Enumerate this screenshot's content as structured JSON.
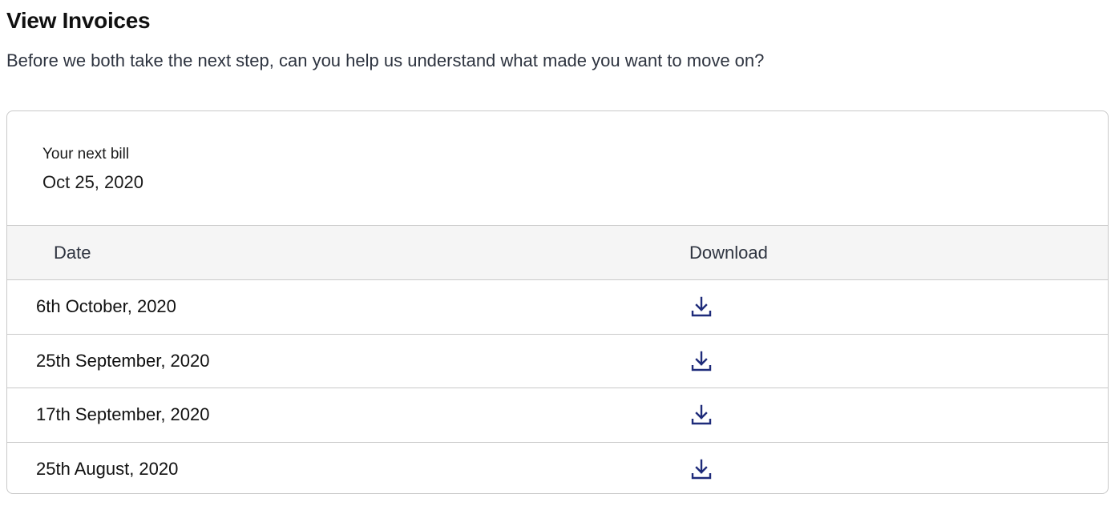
{
  "page": {
    "title": "View Invoices",
    "subtitle": "Before we both take the next step, can you help us understand what made you want to move on?"
  },
  "next_bill": {
    "label": "Your next bill",
    "date": "Oct 25, 2020"
  },
  "table": {
    "columns": [
      "Date",
      "Download"
    ],
    "rows": [
      {
        "date": "6th October, 2020",
        "download_icon": "download-icon"
      },
      {
        "date": "25th September, 2020",
        "download_icon": "download-icon"
      },
      {
        "date": "17th September, 2020",
        "download_icon": "download-icon"
      },
      {
        "date": "25th August, 2020",
        "download_icon": "download-icon"
      }
    ]
  },
  "colors": {
    "icon": "#1e2b7a",
    "border": "#c9c9c9",
    "header_bg": "#f5f5f5"
  }
}
